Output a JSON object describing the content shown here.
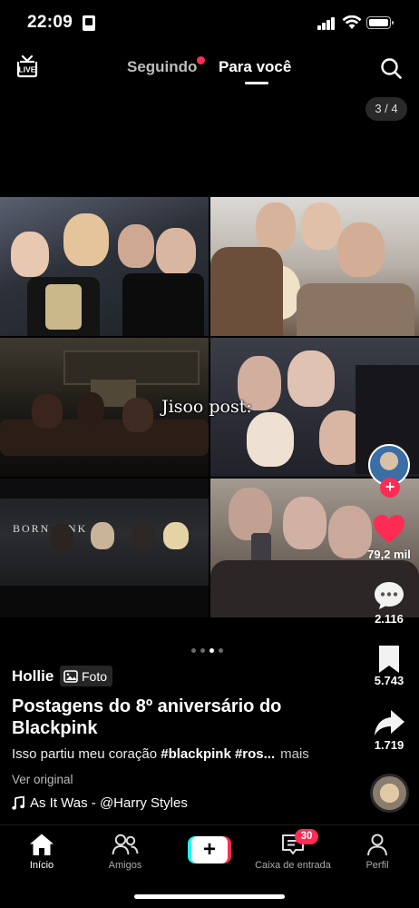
{
  "status_bar": {
    "time": "22:09"
  },
  "top_nav": {
    "tabs": [
      {
        "label": "Seguindo",
        "active": false,
        "has_dot": true
      },
      {
        "label": "Para você",
        "active": true
      }
    ],
    "icons": [
      "live-icon",
      "search-icon"
    ]
  },
  "post": {
    "page_counter": "3 / 4",
    "overlay_text": "Jisoo post:",
    "username": "Hollie",
    "media_badge": "Foto",
    "title": "Postagens do 8º aniversário do Blackpink",
    "description_prefix": "Isso partiu meu coração",
    "hashtags": "#blackpink #ros...",
    "more_label": "mais",
    "see_original": "Ver original",
    "music": "As It Was - @Harry Styles",
    "carousel": {
      "total": 4,
      "current": 3
    }
  },
  "actions": {
    "likes": "79,2 mil",
    "comments": "2.116",
    "saves": "5.743",
    "shares": "1.719",
    "like_color": "#fe2c55"
  },
  "bottom_nav": {
    "items": [
      {
        "label": "Início",
        "icon": "home-icon",
        "active": true
      },
      {
        "label": "Amigos",
        "icon": "friends-icon"
      },
      {
        "label": "",
        "icon": "create-plus-icon"
      },
      {
        "label": "Caixa de entrada",
        "icon": "inbox-icon",
        "badge": "30"
      },
      {
        "label": "Perfil",
        "icon": "profile-icon"
      }
    ]
  },
  "colors": {
    "accent": "#fe2c55",
    "cyan": "#25f4ee",
    "background": "#000000"
  }
}
